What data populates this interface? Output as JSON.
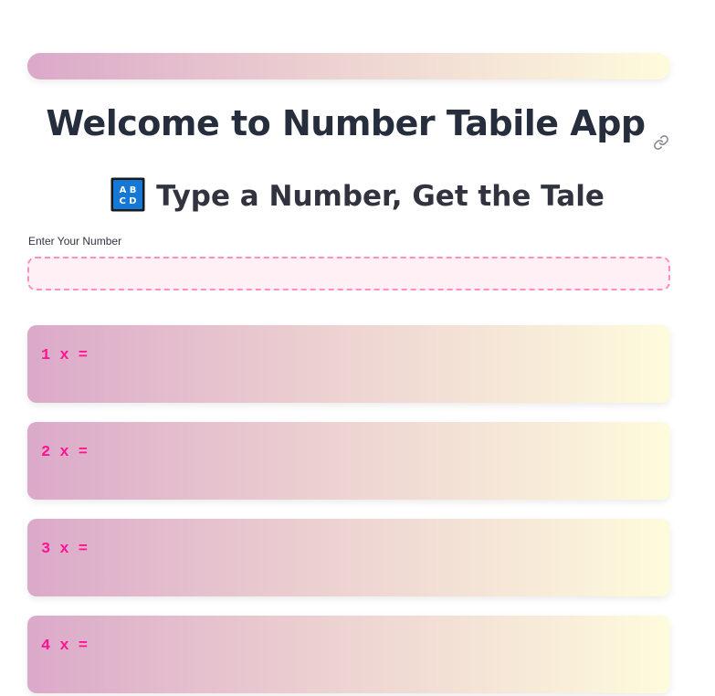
{
  "app": {
    "title": "Welcome to Number Tabile App",
    "link_icon": "link-icon"
  },
  "header": {
    "icon": "abcd-icon",
    "subtitle": "Type a Number, Get the Tale"
  },
  "input": {
    "label": "Enter Your Number",
    "value": "",
    "placeholder": ""
  },
  "table_rows": [
    {
      "text": "1 x ="
    },
    {
      "text": "2 x ="
    },
    {
      "text": "3 x ="
    },
    {
      "text": "4 x ="
    }
  ],
  "colors": {
    "gradient_start": "#dba9c9",
    "gradient_end": "#fefbdc",
    "accent_text": "#ff1493",
    "input_border": "#ff8fbd",
    "input_bg": "#fff0f6",
    "title_text": "#262e3d"
  }
}
